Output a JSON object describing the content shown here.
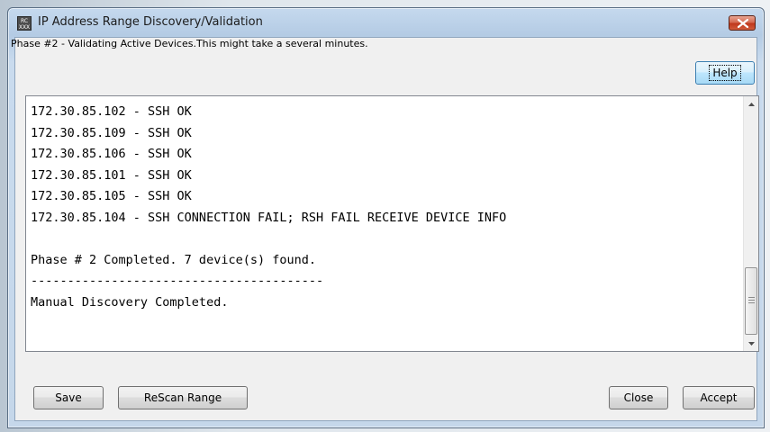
{
  "window": {
    "title": "IP Address Range Discovery/Validation",
    "icon_text": "RC XXX",
    "close_icon": "close-x-icon"
  },
  "phase": {
    "text": "Phase #2 - Validating Active Devices.This might take a several minutes."
  },
  "buttons": {
    "help": "Help",
    "save": "Save",
    "rescan": "ReScan Range",
    "close": "Close",
    "accept": "Accept"
  },
  "log": {
    "lines": [
      "172.30.85.102 - SSH OK",
      "172.30.85.109 - SSH OK",
      "172.30.85.106 - SSH OK",
      "172.30.85.101 - SSH OK",
      "172.30.85.105 - SSH OK",
      "172.30.85.104 - SSH CONNECTION FAIL; RSH FAIL RECEIVE DEVICE INFO",
      "",
      "Phase # 2 Completed. 7 device(s) found.",
      "----------------------------------------",
      "Manual Discovery Completed."
    ]
  },
  "scrollbar": {
    "up_icon": "scroll-up-arrow-icon",
    "down_icon": "scroll-down-arrow-icon",
    "position": "bottom"
  },
  "colors": {
    "title_bar": "#b4cbe4",
    "close_button": "#c0391d",
    "focused_button": "#bee6fd"
  }
}
